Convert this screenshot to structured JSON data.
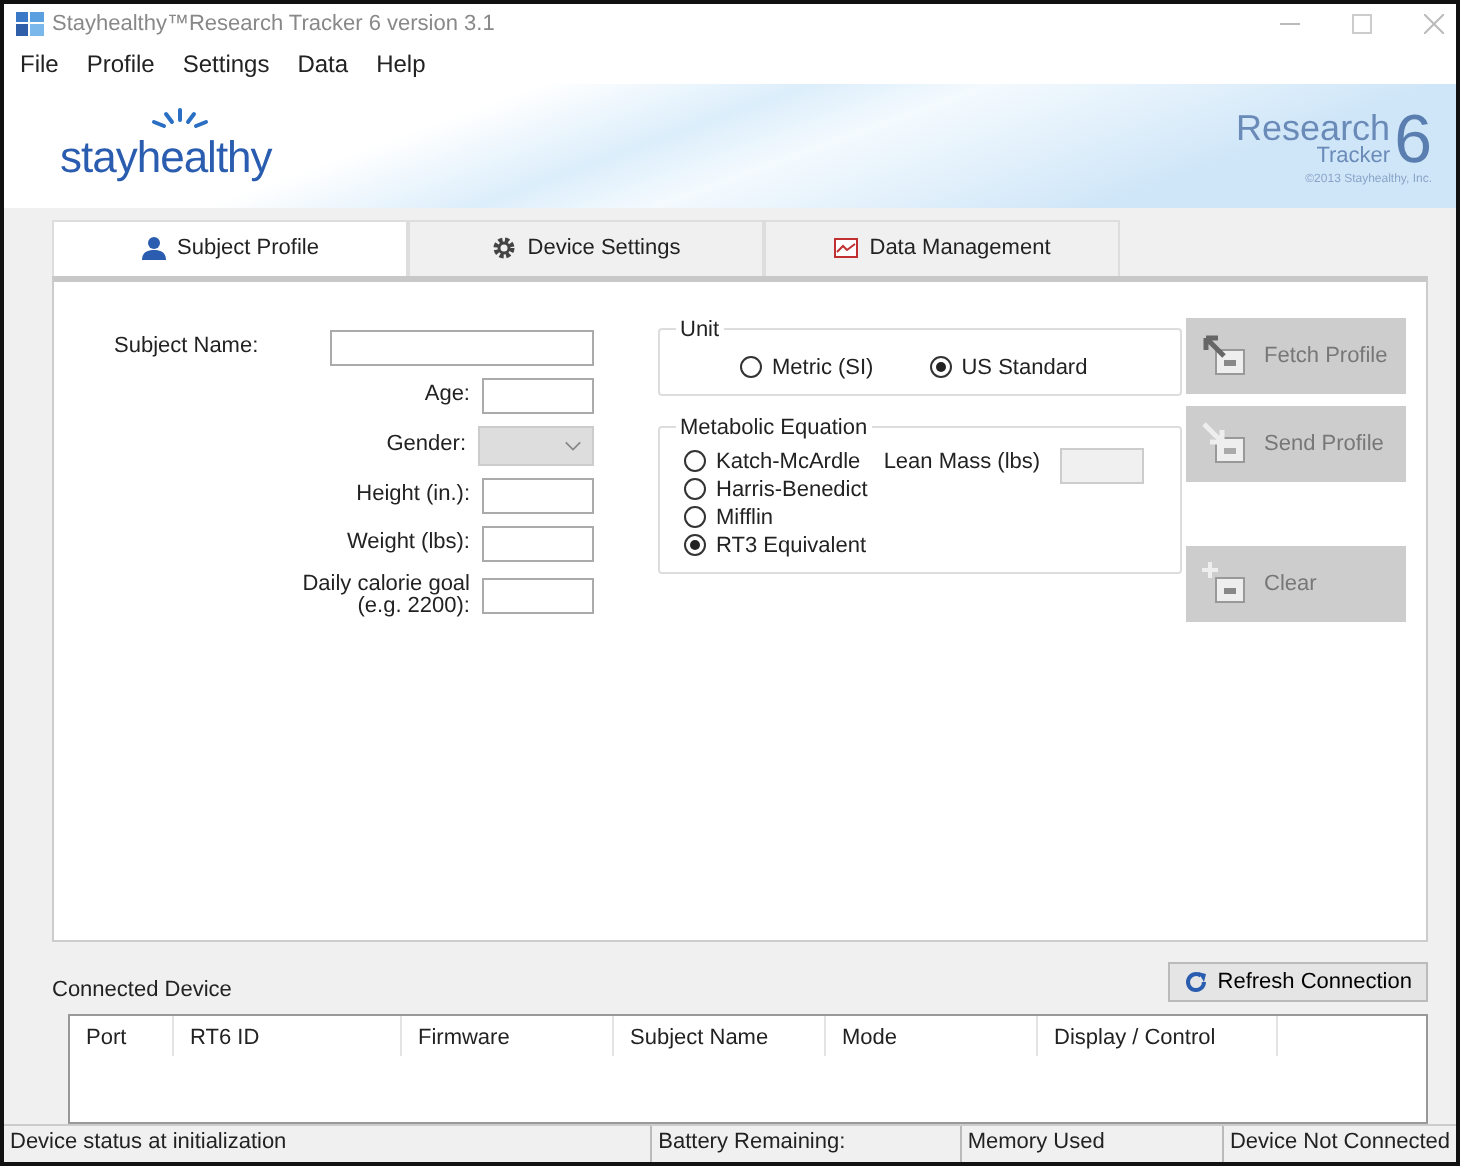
{
  "window": {
    "title": "Stayhealthy™Research Tracker 6 version 3.1"
  },
  "menu": [
    "File",
    "Profile",
    "Settings",
    "Data",
    "Help"
  ],
  "banner": {
    "logo": "stayhealthy",
    "product": "Research",
    "product_sub": "Tracker",
    "product_number": "6",
    "copyright": "©2013 Stayhealthy, Inc."
  },
  "tabs": [
    {
      "label": "Subject Profile",
      "selected": true
    },
    {
      "label": "Device Settings",
      "selected": false
    },
    {
      "label": "Data Management",
      "selected": false
    }
  ],
  "fields": [
    {
      "kind": "text",
      "label": "Subject Name:"
    },
    {
      "kind": "text",
      "label": "Age:"
    },
    {
      "kind": "select",
      "label": "Gender:",
      "disabled": true
    },
    {
      "kind": "text",
      "label": "Height (in.):"
    },
    {
      "kind": "text",
      "label": "Weight (lbs):"
    },
    {
      "kind": "text",
      "label": "Daily calorie goal\n(e.g. 2200):"
    }
  ],
  "unit": {
    "title": "Unit",
    "options": [
      {
        "label": "Metric (SI)",
        "selected": false
      },
      {
        "label": "US Standard",
        "selected": true
      }
    ]
  },
  "equation": {
    "title": "Metabolic Equation",
    "options": [
      {
        "label": "Katch-McArdle",
        "selected": false
      },
      {
        "label": "Harris-Benedict",
        "selected": false
      },
      {
        "label": "Mifflin",
        "selected": false
      },
      {
        "label": "RT3 Equivalent",
        "selected": true
      }
    ],
    "lean_mass": {
      "label": "Lean Mass (lbs)",
      "disabled": true
    }
  },
  "actions": [
    {
      "label": "Fetch Profile",
      "disabled": true
    },
    {
      "label": "Send Profile",
      "disabled": true
    },
    {
      "label": "Clear",
      "disabled": true
    }
  ],
  "connected_device": {
    "title": "Connected Device",
    "refresh": "Refresh Connection",
    "columns": [
      "Port",
      "RT6 ID",
      "Firmware",
      "Subject Name",
      "Mode",
      "Display / Control"
    ]
  },
  "status_bar": [
    "Device status at initialization",
    "Battery Remaining:",
    "Memory Used",
    "Device Not Connected"
  ]
}
